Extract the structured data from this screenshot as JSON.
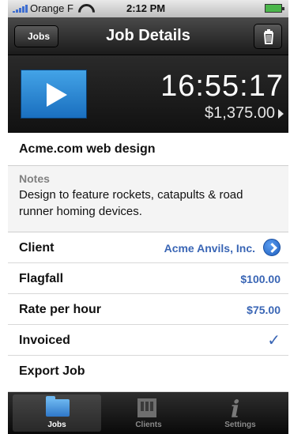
{
  "status_bar": {
    "carrier": "Orange F",
    "time": "2:12 PM"
  },
  "nav": {
    "back_label": "Jobs",
    "title": "Job Details"
  },
  "timer": {
    "elapsed": "16:55:17",
    "amount": "$1,375.00"
  },
  "job": {
    "name": "Acme.com web design"
  },
  "notes": {
    "label": "Notes",
    "text": "Design to feature rockets, catapults & road runner homing devices."
  },
  "rows": {
    "client": {
      "label": "Client",
      "value": "Acme Anvils, Inc."
    },
    "flagfall": {
      "label": "Flagfall",
      "value": "$100.00"
    },
    "rate": {
      "label": "Rate per hour",
      "value": "$75.00"
    },
    "invoiced": {
      "label": "Invoiced",
      "value": "✓"
    },
    "export": {
      "label": "Export Job"
    }
  },
  "tabs": [
    {
      "label": "Jobs",
      "icon": "folder-icon",
      "active": true
    },
    {
      "label": "Clients",
      "icon": "building-icon",
      "active": false
    },
    {
      "label": "Settings",
      "icon": "info-icon",
      "active": false
    }
  ],
  "colors": {
    "accent_blue": "#3a66b5",
    "play_button": "#2a86d6"
  }
}
